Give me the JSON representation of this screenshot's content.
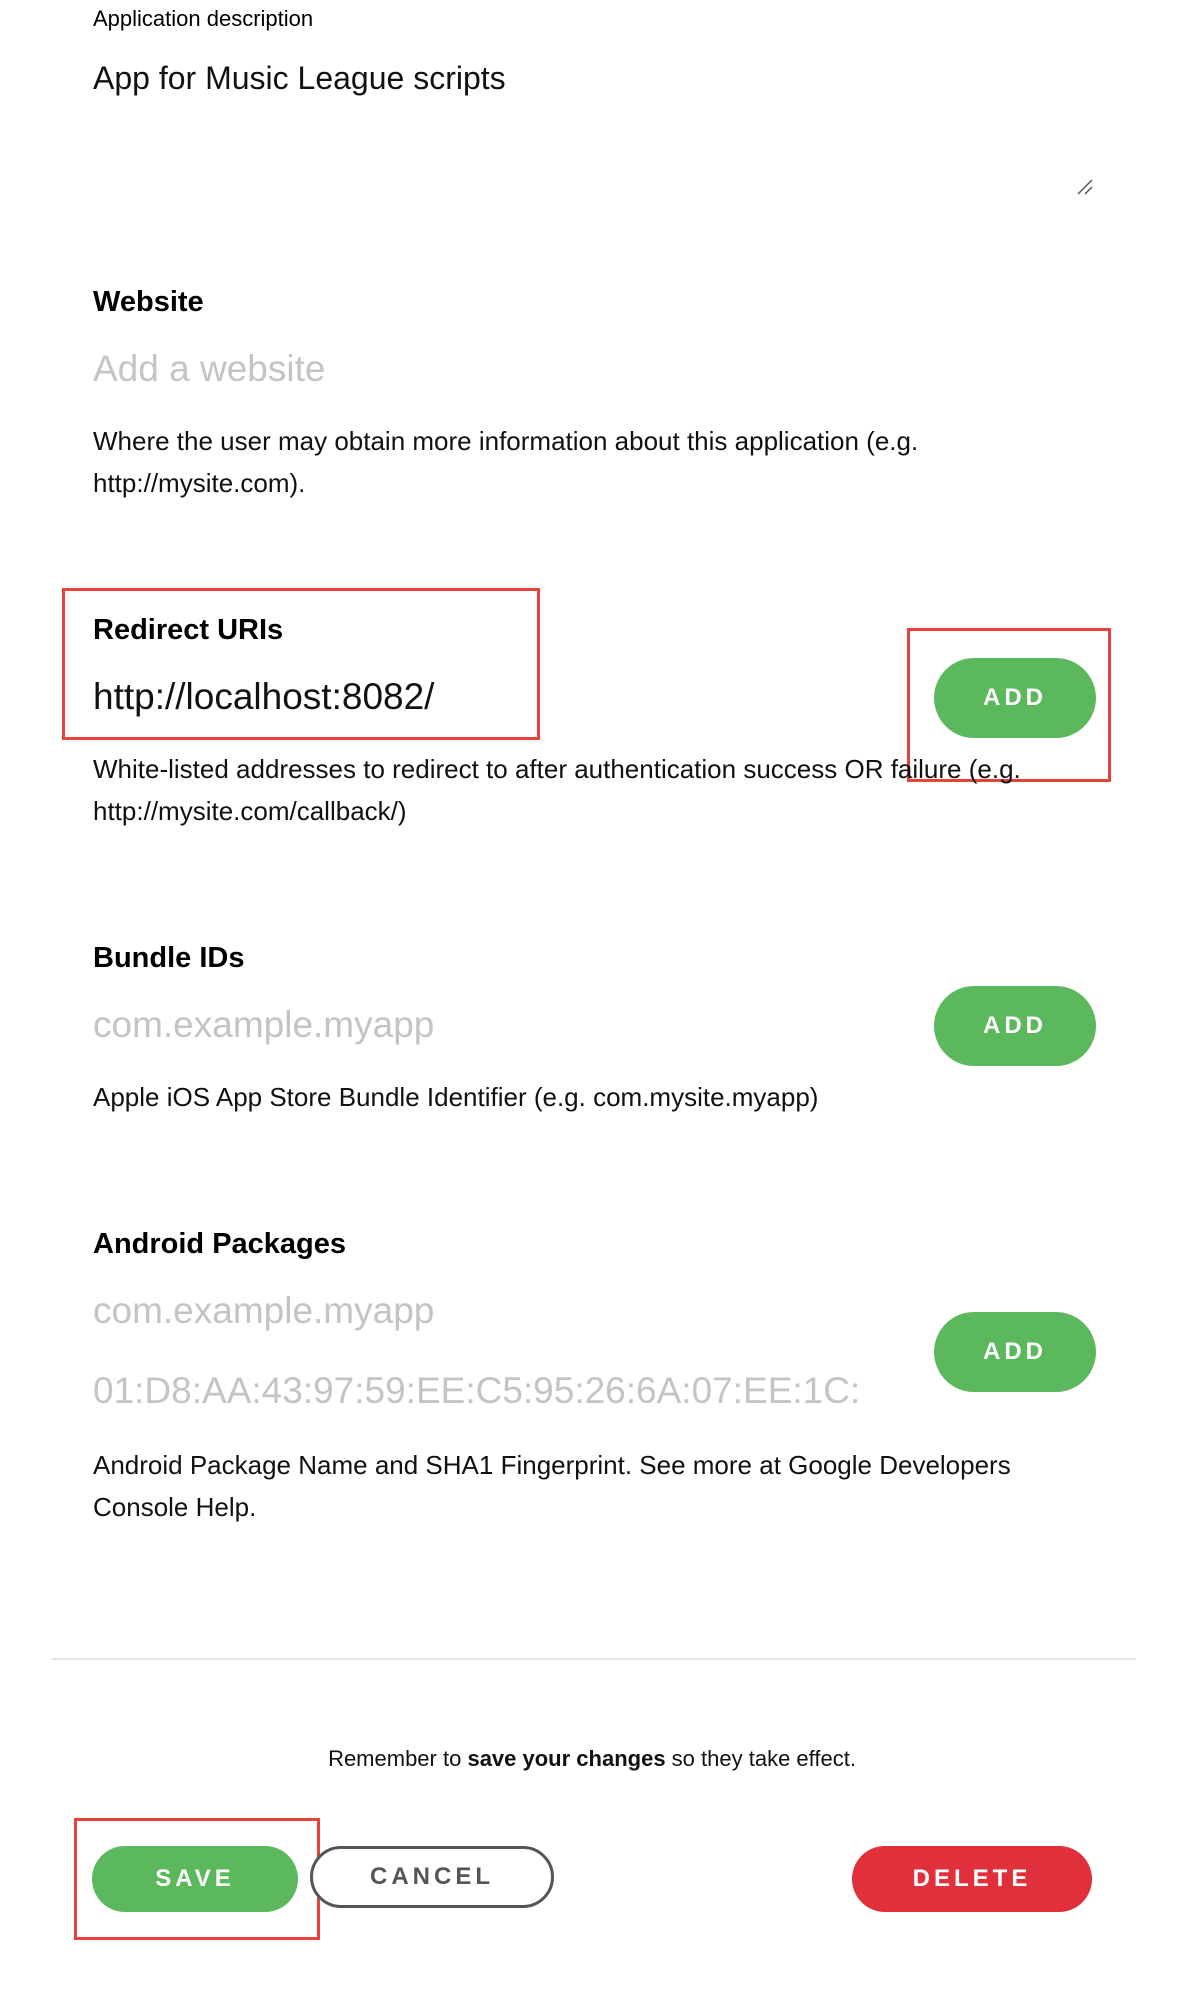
{
  "app_description": {
    "label": "Application description",
    "value": "App for Music League scripts"
  },
  "website": {
    "heading": "Website",
    "placeholder": "Add a website",
    "help_line1": "Where the user may obtain more information about this application (e.g.",
    "help_line2": "http://mysite.com)."
  },
  "redirect": {
    "heading": "Redirect URIs",
    "value": "http://localhost:8082/",
    "add_label": "ADD",
    "help_line1": "White-listed addresses to redirect to after authentication success OR failure (e.g.",
    "help_line2": "http://mysite.com/callback/)"
  },
  "bundle": {
    "heading": "Bundle IDs",
    "placeholder": "com.example.myapp",
    "add_label": "ADD",
    "help": "Apple iOS App Store Bundle Identifier (e.g. com.mysite.myapp)"
  },
  "android": {
    "heading": "Android Packages",
    "package_placeholder": "com.example.myapp",
    "fingerprint_placeholder": "01:D8:AA:43:97:59:EE:C5:95:26:6A:07:EE:1C:",
    "add_label": "ADD",
    "help_line1": "Android Package Name and SHA1 Fingerprint. See more at Google Developers",
    "help_line2": "Console Help."
  },
  "footer": {
    "note_pre": "Remember to ",
    "note_bold": "save your changes",
    "note_post": " so they take effect.",
    "save_label": "SAVE",
    "cancel_label": "CANCEL",
    "delete_label": "DELETE"
  },
  "colors": {
    "green": "#5cb85c",
    "red": "#e0303b",
    "highlight": "#e5443a"
  }
}
